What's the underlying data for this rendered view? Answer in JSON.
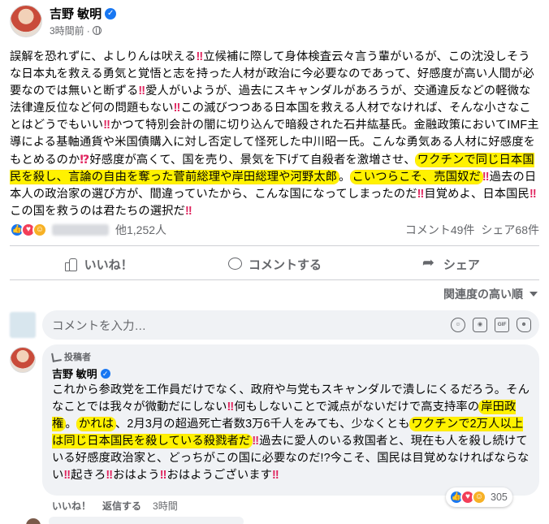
{
  "post": {
    "author": "吉野 敏明",
    "time": "3時間前",
    "body_segments": [
      {
        "t": "誤解を恐れずに、よしりんは吠える",
        "k": "n"
      },
      {
        "t": "‼",
        "k": "b"
      },
      {
        "t": "立候補に際して身体検査云々言う輩がいるが、この沈没しそうな日本丸を救える勇気と覚悟と志を持った人材が政治に今必要なのであって、好感度が高い人間が必要なのでは無いと断ずる",
        "k": "n"
      },
      {
        "t": "‼",
        "k": "b"
      },
      {
        "t": "愛人がいようが、過去にスキャンダルがあろうが、交通違反などの軽微な法律違反位など何の問題もない",
        "k": "n"
      },
      {
        "t": "‼",
        "k": "b"
      },
      {
        "t": "この滅びつつある日本国を救える人材でなければ、そんな小さなことはどうでもいい",
        "k": "n"
      },
      {
        "t": "‼",
        "k": "b"
      },
      {
        "t": "かつて特別会計の闇に切り込んで暗殺された石井紘基氏。金融政策においてIMF主導による基軸通貨や米国債購入に対し否定して怪死した中川昭一氏。こんな勇気ある人材に好感度をもとめるのか",
        "k": "n"
      },
      {
        "t": "⁉",
        "k": "b"
      },
      {
        "t": "好感度が高くて、国を売り、景気を下げて自殺者を激増させ、",
        "k": "n"
      },
      {
        "t": "ワクチンで同じ日本国民を殺し、言論の自由を奪った菅前総理や岸田総理や河野太郎",
        "k": "h"
      },
      {
        "t": "。",
        "k": "n"
      },
      {
        "t": "こいつらこそ、売国奴だ",
        "k": "h"
      },
      {
        "t": "‼",
        "k": "b"
      },
      {
        "t": "過去の日本人の政治家の選び方が、間違っていたから、こんな国になってしまったのだ",
        "k": "n"
      },
      {
        "t": "‼",
        "k": "b"
      },
      {
        "t": "目覚めよ、日本国民",
        "k": "n"
      },
      {
        "t": "‼",
        "k": "b"
      },
      {
        "t": "この国を救うのは君たちの選択だ",
        "k": "n"
      },
      {
        "t": "‼",
        "k": "b"
      }
    ],
    "reactions_others": "他1,252人",
    "comments_count": "コメント49件",
    "shares_count": "シェア68件"
  },
  "actions": {
    "like": "いいね！",
    "comment": "コメントする",
    "share": "シェア"
  },
  "sort": {
    "label": "関連度の高い順"
  },
  "comment_input": {
    "placeholder": "コメントを入力…",
    "gif_label": "GIF"
  },
  "reply": {
    "badge": "投稿者",
    "author": "吉野 敏明",
    "text_segments": [
      {
        "t": "これから参政党を工作員だけでなく、政府や与党もスキャンダルで潰しにくるだろう。そんなことでは我々が微動だにしない",
        "k": "n"
      },
      {
        "t": "‼",
        "k": "b"
      },
      {
        "t": "何もしないことで減点がないだけで高支持率の",
        "k": "n"
      },
      {
        "t": "岸田政権",
        "k": "h"
      },
      {
        "t": "。",
        "k": "n"
      },
      {
        "t": "かれは",
        "k": "h"
      },
      {
        "t": "、2月3月の超過死亡者数3万6千人をみても、少なくとも",
        "k": "n"
      },
      {
        "t": "ワクチンで2万人以上は同じ日本国民を殺している殺戮者だ",
        "k": "h"
      },
      {
        "t": "‼",
        "k": "b"
      },
      {
        "t": "過去に愛人のいる救国者と、現在も人を殺し続けている好感度政治家と、どっちがこの国に必要なのだ!?今こそ、国民は目覚めなければならない",
        "k": "n"
      },
      {
        "t": "‼",
        "k": "b"
      },
      {
        "t": "起きろ",
        "k": "n"
      },
      {
        "t": "‼",
        "k": "b"
      },
      {
        "t": "おはよう",
        "k": "n"
      },
      {
        "t": "‼",
        "k": "b"
      },
      {
        "t": "おはようございます",
        "k": "n"
      },
      {
        "t": "‼",
        "k": "b"
      }
    ],
    "reaction_count": "305",
    "like": "いいね！",
    "reply": "返信する",
    "time": "3時間"
  },
  "colors": {
    "highlight": "#fff200",
    "brand": "#1877f2",
    "bang": "#e0245e"
  }
}
